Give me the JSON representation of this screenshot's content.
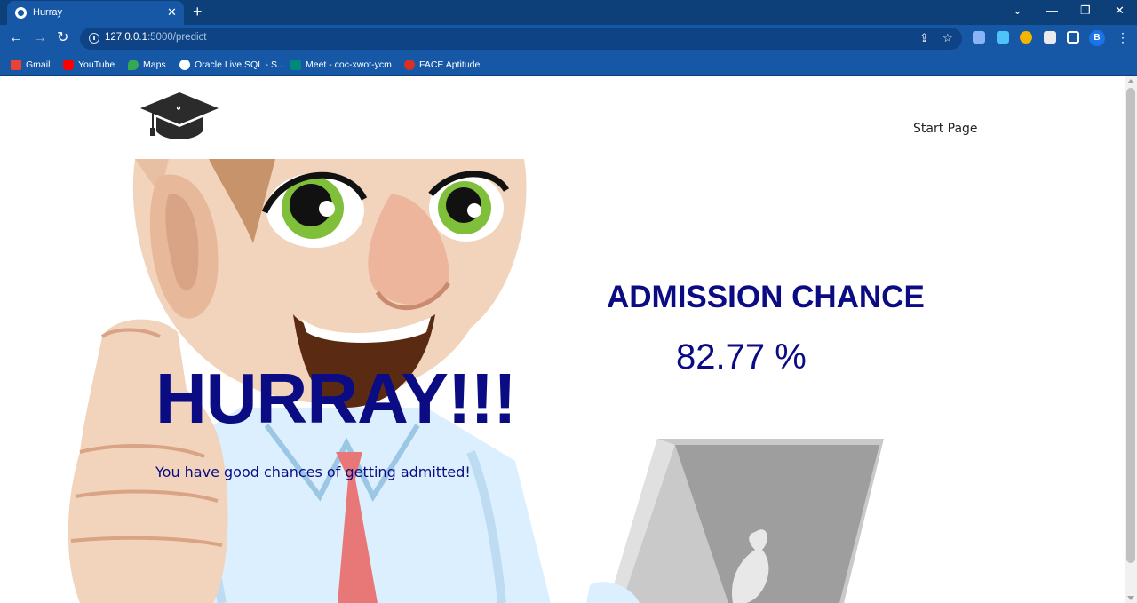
{
  "browser": {
    "tab": {
      "title": "Hurray"
    },
    "url": {
      "host": "127.0.0.1",
      "path": ":5000/predict"
    },
    "profile_initial": "B",
    "bookmarks": [
      {
        "label": "Gmail",
        "icon": "gmail-icon",
        "color": "#ea4335"
      },
      {
        "label": "YouTube",
        "icon": "youtube-icon",
        "color": "#ff0000"
      },
      {
        "label": "Maps",
        "icon": "maps-icon",
        "color": "#34a853"
      },
      {
        "label": "Oracle Live SQL - S...",
        "icon": "globe-icon",
        "color": "#ffffff"
      },
      {
        "label": "Meet - coc-xwot-ycm",
        "icon": "meet-icon",
        "color": "#00897b"
      },
      {
        "label": "FACE Aptitude",
        "icon": "face-icon",
        "color": "#d93025"
      }
    ]
  },
  "page": {
    "nav": {
      "start_page": "Start Page"
    },
    "heading": "HURRAY!!!",
    "message": "You have good chances of getting admitted!",
    "result_title": "ADMISSION CHANCE",
    "result_value": "82.77 %"
  },
  "colors": {
    "accent": "#0b0b84",
    "chrome": "#1658a6",
    "chrome_dark": "#0d3f78"
  }
}
